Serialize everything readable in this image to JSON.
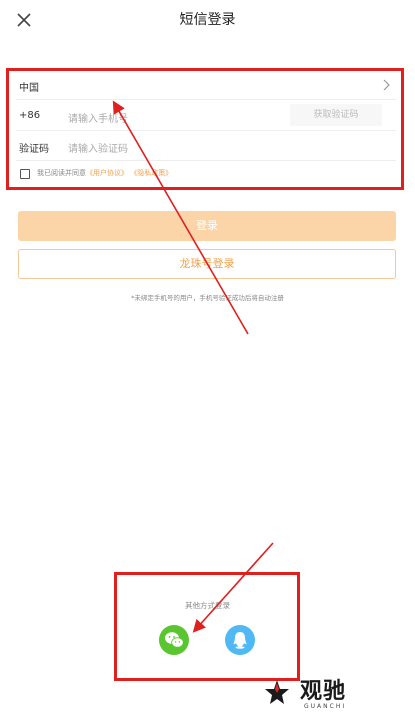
{
  "header": {
    "title": "短信登录"
  },
  "form": {
    "region_label": "中国",
    "country_code": "+86",
    "phone_placeholder": "请输入手机号",
    "get_code_label": "获取验证码",
    "code_label": "验证码",
    "code_placeholder": "请输入验证码",
    "agreement_prefix": "我已阅读并同意",
    "user_agreement_link": "《用户协议》",
    "privacy_link": "《隐私政策》"
  },
  "buttons": {
    "login_label": "登录",
    "longzhu_login_label": "龙珠号登录"
  },
  "note": "*未绑定手机号的用户，手机号验证成功后将自动注册",
  "other_login": {
    "label": "其他方式登录"
  },
  "watermark": {
    "text": "观驰",
    "sub": "GUANCHI"
  },
  "colors": {
    "accent": "#f0a24e",
    "login_button_disabled": "#fbd5a8",
    "annotation_red": "#e01f1f",
    "wechat_green": "#5ac62f",
    "qq_blue": "#4fb8f5"
  },
  "icons": [
    "close-icon",
    "chevron-right-icon",
    "wechat-icon",
    "qq-icon"
  ]
}
